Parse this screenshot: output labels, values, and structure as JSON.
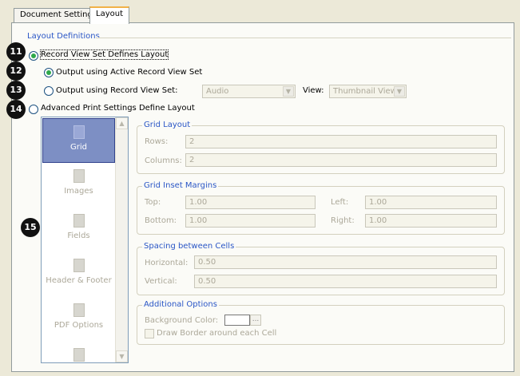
{
  "tabs": [
    {
      "label": "Document Settings",
      "active": false
    },
    {
      "label": "Layout",
      "active": true
    }
  ],
  "layout_definitions": {
    "title": "Layout Definitions",
    "record_view_set_defines": {
      "label": "Record View Set Defines Layout",
      "checked": true
    },
    "output_active_set": {
      "label": "Output using Active Record View Set",
      "checked": true
    },
    "output_record_set": {
      "label": "Output using Record View Set:",
      "checked": false
    },
    "record_set_value": "Audio",
    "view_label": "View:",
    "view_value": "Thumbnail View",
    "advanced_print": {
      "label": "Advanced Print Settings Define Layout",
      "checked": false
    }
  },
  "callouts": [
    "11",
    "12",
    "13",
    "14",
    "15"
  ],
  "nav": {
    "items": [
      {
        "label": "Grid",
        "icon": "grid-icon",
        "selected": true
      },
      {
        "label": "Images",
        "icon": "images-icon",
        "selected": false
      },
      {
        "label": "Fields",
        "icon": "fields-icon",
        "selected": false
      },
      {
        "label": "Header & Footer",
        "icon": "header-footer-icon",
        "selected": false
      },
      {
        "label": "PDF Options",
        "icon": "pdf-options-icon",
        "selected": false
      },
      {
        "label": "",
        "icon": "more-options-icon",
        "selected": false
      }
    ]
  },
  "grid_layout": {
    "title": "Grid Layout",
    "rows_label": "Rows:",
    "rows_value": "2",
    "columns_label": "Columns:",
    "columns_value": "2"
  },
  "grid_inset_margins": {
    "title": "Grid Inset Margins",
    "top_label": "Top:",
    "top_value": "1.00",
    "left_label": "Left:",
    "left_value": "1.00",
    "bottom_label": "Bottom:",
    "bottom_value": "1.00",
    "right_label": "Right:",
    "right_value": "1.00"
  },
  "spacing": {
    "title": "Spacing between Cells",
    "horizontal_label": "Horizontal:",
    "horizontal_value": "0.50",
    "vertical_label": "Vertical:",
    "vertical_value": "0.50"
  },
  "additional_options": {
    "title": "Additional Options",
    "bg_color_label": "Background Color:",
    "bg_color_button": "...",
    "draw_border_label": "Draw Border around each Cell",
    "draw_border_checked": false
  },
  "colors": {
    "accent": "#2a56c6",
    "selected_nav": "#7d8fc4",
    "radio_dot": "#2ea84a"
  }
}
